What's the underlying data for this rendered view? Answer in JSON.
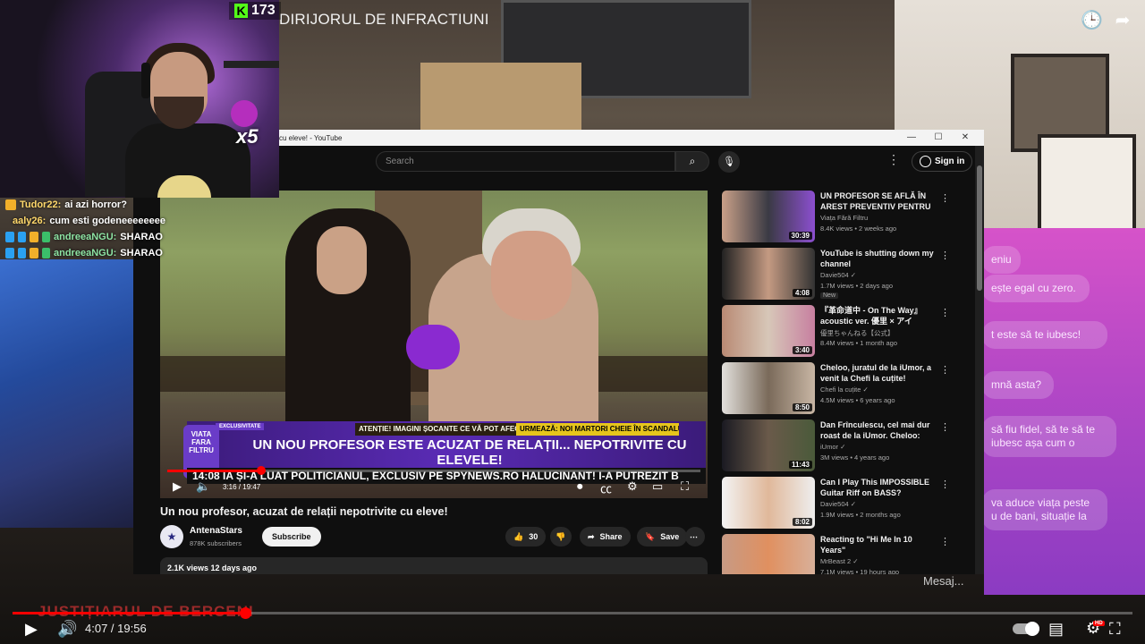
{
  "video_title": "DIRIJORUL DE INFRACTIUNI",
  "top_icons": [
    "watch-later-icon",
    "share-icon"
  ],
  "stream": {
    "viewer_count": "173",
    "platform_icon": "K",
    "overlay_multiplier": "x5"
  },
  "chat": [
    {
      "user": "Tudor22:",
      "message": "ai azi horror?"
    },
    {
      "user": "aaly26:",
      "message": "cum esti godeneeeeeeee"
    },
    {
      "user": "andreeaNGU:",
      "message": "SHARAO"
    },
    {
      "user": "andreeaNGU:",
      "message": "SHARAO"
    }
  ],
  "browser": {
    "tab_title": "cu eleve! - YouTube",
    "search_placeholder": "Search",
    "sign_in": "Sign in",
    "window_controls": [
      "—",
      "☐",
      "✕"
    ]
  },
  "player": {
    "lower_third_exclusive": "EXCLUSIVITATE",
    "logo_text": "VIATA FARA FILTRU",
    "ticker_warning": "ATENȚIE! IMAGINI ȘOCANTE CE VĂ POT AFECTA EMOȚIONAL!",
    "ticker_next": "URMEAZĂ: NOI MARTORI CHEIE ÎN SCANDALUL DIN CRAIOVA!",
    "headline": "UN NOU PROFESOR ESTE ACUZAT DE RELAȚII... NEPOTRIVITE CU ELEVELE!",
    "crawl": "14:08  IA ȘI-A LUAT POLITICIANUL, EXCLUSIV PE SPYNEWS.RO  HALUCINANT! I-A PUTREZIT B",
    "time": "3:16 / 19:47",
    "progress": 0.176
  },
  "video": {
    "title": "Un nou profesor, acuzat de relații nepotrivite cu eleve!",
    "channel": "AntenaStars",
    "subscribers": "878K subscribers",
    "subscribe": "Subscribe",
    "likes": "30",
    "share": "Share",
    "save": "Save",
    "views_date": "2.1K views  12 days ago"
  },
  "suggestions": [
    {
      "title": "UN PROFESOR SE AFLĂ ÎN AREST PREVENTIV PENTRU ...",
      "channel": "Viața Fără Filtru",
      "meta": "8.4K views • 2 weeks ago",
      "duration": "30:39",
      "badge": ""
    },
    {
      "title": "YouTube is shutting down my channel",
      "channel": "Davie504 ✓",
      "meta": "1.7M views • 2 days ago",
      "duration": "4:08",
      "badge": "New"
    },
    {
      "title": "『革命道中 - On The Way』 acoustic ver. 優里 × アイナ・...",
      "channel": "優里ちゃんねる【公式】",
      "meta": "8.4M views • 1 month ago",
      "duration": "3:40",
      "badge": ""
    },
    {
      "title": "Cheloo, juratul de la iUmor, a venit la Chefi la cuțite!",
      "channel": "Chefi la cuțite ✓",
      "meta": "4.5M views • 6 years ago",
      "duration": "8:50",
      "badge": ""
    },
    {
      "title": "Dan Frînculescu, cel mai dur roast de la iUmor. Cheloo: „Ma...",
      "channel": "iUmor ✓",
      "meta": "3M views • 4 years ago",
      "duration": "11:43",
      "badge": ""
    },
    {
      "title": "Can I Play This IMPOSSIBLE Guitar Riff on BASS?",
      "channel": "Davie504 ✓",
      "meta": "1.9M views • 2 months ago",
      "duration": "8:02",
      "badge": ""
    },
    {
      "title": "Reacting to \"Hi Me In 10 Years\"",
      "channel": "MrBeast 2 ✓",
      "meta": "7.1M views • 19 hours ago",
      "duration": "",
      "badge": ""
    }
  ],
  "backdrop_chat": [
    "eniu",
    "ește egal cu zero.",
    "t este să te iubesc!",
    "mnă asta?",
    "să fiu fidel, să te să te iubesc așa cum o",
    "va aduce viața peste u de bani, situație la",
    "Mesaj..."
  ],
  "bottom_player": {
    "overlay_title": "JUSTIȚIARUL DE BERCENI",
    "time": "4:07 / 19:56",
    "progress": 0.208,
    "hd_badge": "HD"
  }
}
